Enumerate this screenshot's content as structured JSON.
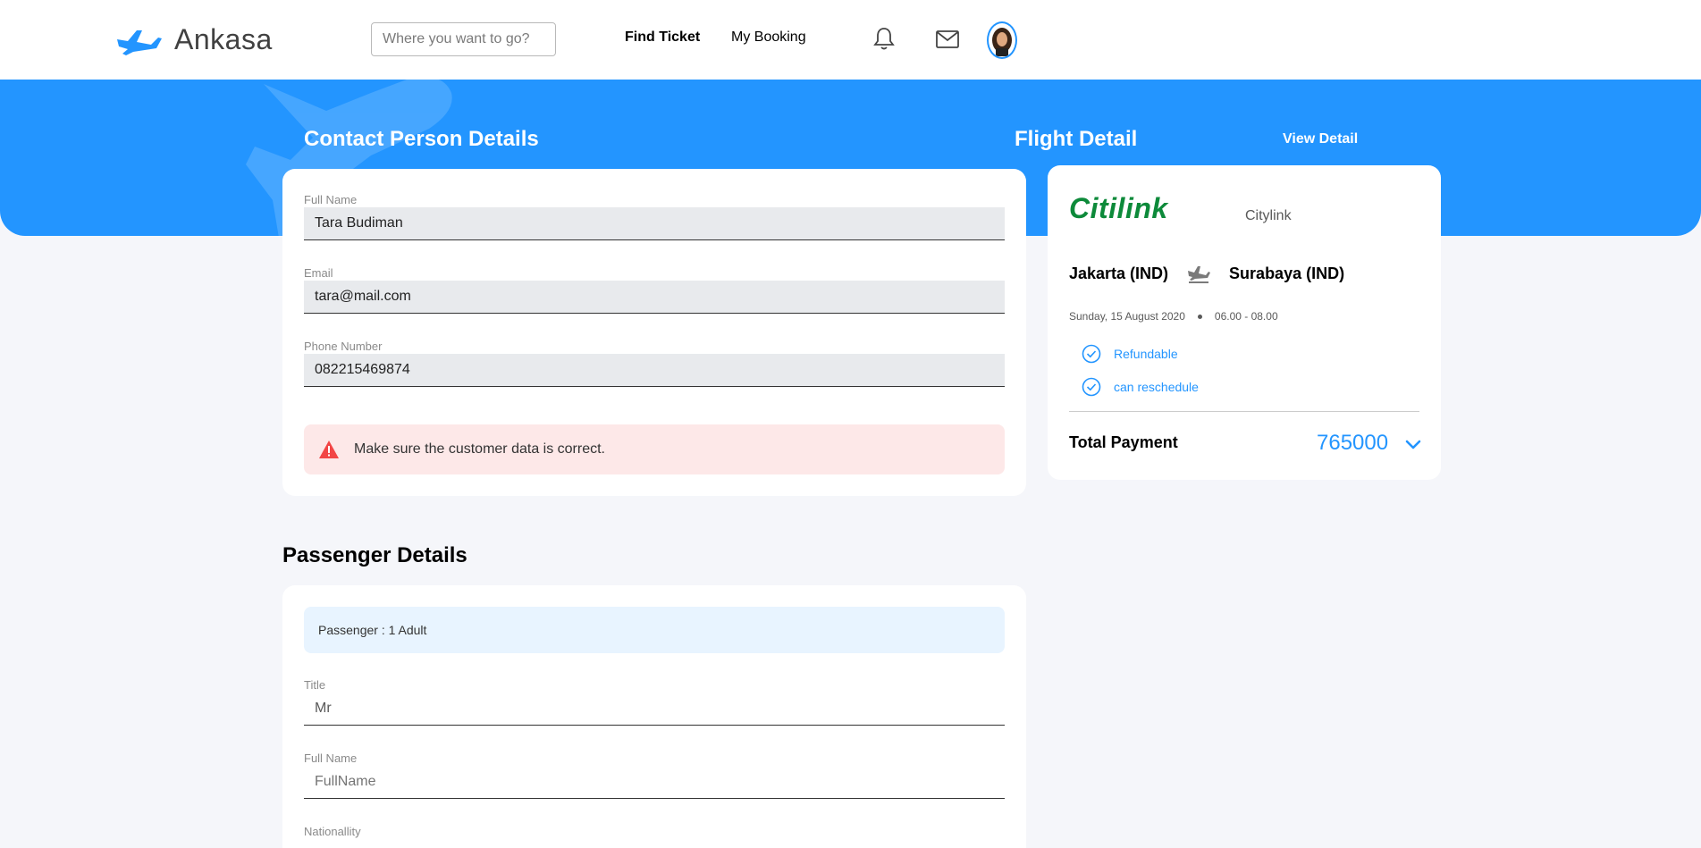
{
  "navbar": {
    "brand": "Ankasa",
    "search_placeholder": "Where you want to go?",
    "links": [
      "Find Ticket",
      "My Booking"
    ],
    "icons": [
      "bell-icon",
      "mail-icon"
    ],
    "brand_color": "#2395ff"
  },
  "contact": {
    "title": "Contact Person Details",
    "fields": [
      {
        "label": "Full Name",
        "value": "Tara Budiman"
      },
      {
        "label": "Email",
        "value": "tara@mail.com"
      },
      {
        "label": "Phone Number",
        "value": "082215469874"
      }
    ],
    "alert": "Make sure the customer data is correct.",
    "alert_icon": "warning-icon"
  },
  "passenger": {
    "title": "Passenger Details",
    "summary": "Passenger : 1 Adult",
    "fields": [
      {
        "label": "Title",
        "value": "Mr"
      },
      {
        "label": "Full Name",
        "placeholder": "FullName"
      },
      {
        "label": "Nationallity"
      }
    ]
  },
  "flight": {
    "title": "Flight Detail",
    "view_detail": "View Detail",
    "airline_logo": "Citilink",
    "airline_name": "Citylink",
    "from": "Jakarta (IND)",
    "to": "Surabaya (IND)",
    "date": "Sunday, 15 August 2020",
    "time": "06.00 - 08.00",
    "features": [
      "Refundable",
      "can reschedule"
    ],
    "total_label": "Total Payment",
    "total_value": "765000",
    "accent": "#2395ff"
  }
}
